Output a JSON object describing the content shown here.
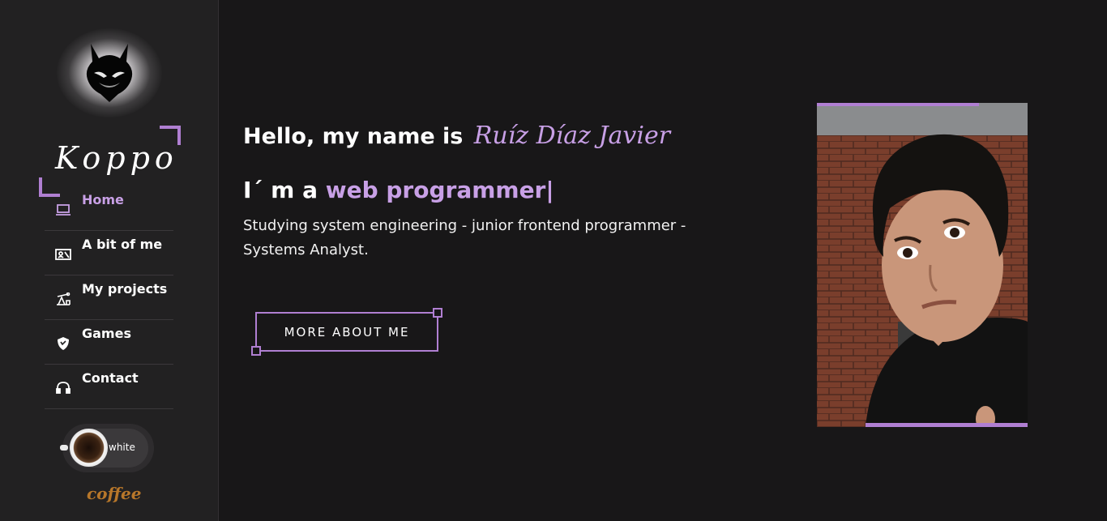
{
  "sidebar": {
    "brand": "Koppo",
    "nav": [
      {
        "label": "Home",
        "icon": "laptop-icon",
        "active": true
      },
      {
        "label": "A bit of me",
        "icon": "id-card-icon",
        "active": false
      },
      {
        "label": "My projects",
        "icon": "oil-pump-icon",
        "active": false
      },
      {
        "label": "Games",
        "icon": "shield-icon",
        "active": false
      },
      {
        "label": "Contact",
        "icon": "headset-icon",
        "active": false
      }
    ],
    "theme_toggle": {
      "label": "white"
    },
    "coffee_label": "coffee"
  },
  "hero": {
    "greeting": "Hello, my name is",
    "name": "Ruíz Díaz Javier",
    "role_prefix": "I´ m a",
    "role_highlight": "web programmer|",
    "description": "Studying system engineering - junior frontend programmer - Systems Analyst.",
    "cta_label": "MORE ABOUT ME"
  },
  "colors": {
    "accent": "#b07fd2",
    "accent_light": "#c8a0e6",
    "background": "#181718",
    "sidebar": "#222122",
    "coffee": "#b8772a"
  }
}
